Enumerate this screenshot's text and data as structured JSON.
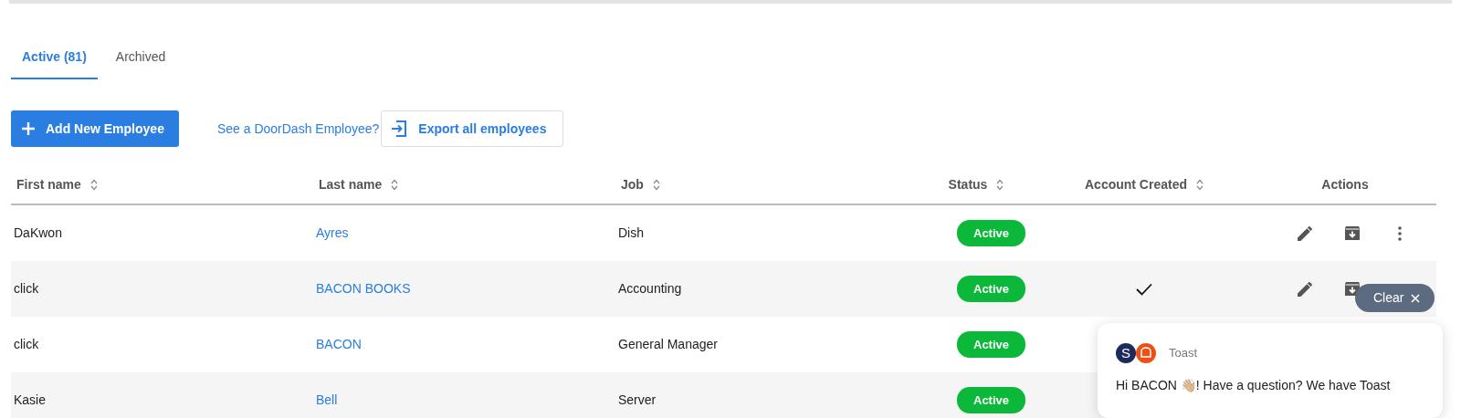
{
  "tabs": [
    {
      "label": "Active (81)",
      "selected": true
    },
    {
      "label": "Archived",
      "selected": false
    }
  ],
  "toolbar": {
    "add_button": "Add New Employee",
    "doordash_link": "See a DoorDash Employee?",
    "export_button": "Export all employees"
  },
  "table": {
    "columns": [
      {
        "label": "First name",
        "sortable": true
      },
      {
        "label": "Last name",
        "sortable": true
      },
      {
        "label": "Job",
        "sortable": true
      },
      {
        "label": "Status",
        "sortable": true
      },
      {
        "label": "Account Created",
        "sortable": true
      },
      {
        "label": "Actions",
        "sortable": false
      }
    ],
    "rows": [
      {
        "first_name": "DaKwon",
        "last_name": "Ayres",
        "job": "Dish",
        "status": "Active",
        "account_created": false,
        "actions": [
          {
            "kind": "edit"
          },
          {
            "kind": "archive"
          },
          {
            "kind": "more"
          }
        ]
      },
      {
        "first_name": "click",
        "last_name": "BACON BOOKS",
        "job": "Accounting",
        "status": "Active",
        "account_created": true,
        "actions": [
          {
            "kind": "edit"
          },
          {
            "kind": "archive"
          }
        ]
      },
      {
        "first_name": "click",
        "last_name": "BACON",
        "job": "General Manager",
        "status": "Active"
      },
      {
        "first_name": "Kasie",
        "last_name": "Bell",
        "job": "Server",
        "status": "Active"
      }
    ]
  },
  "clear_button": "Clear",
  "chat": {
    "sender": "Toast",
    "avatar_letter": "S",
    "message": "Hi BACON 👋🏼! Have a question? We have Toast"
  }
}
